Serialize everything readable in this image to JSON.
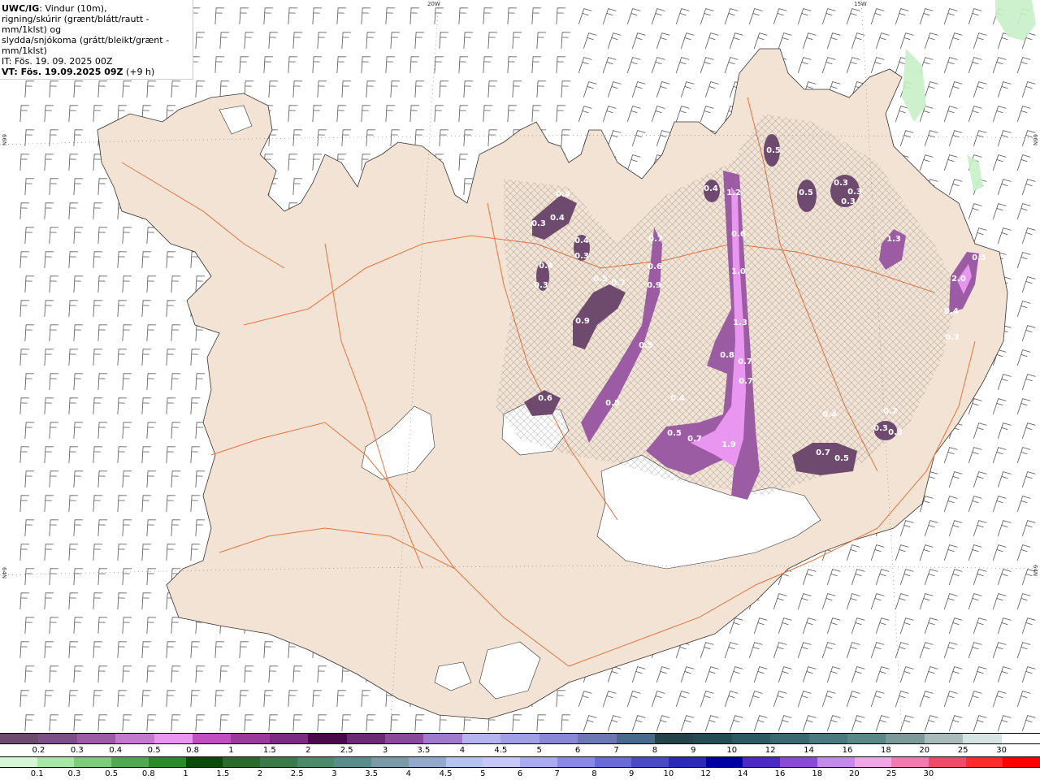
{
  "header": {
    "product": "UWC/IG",
    "desc1": ": Vindur (10m),",
    "desc2": "rigning/skúrir (grænt/blátt/rautt - mm/1klst) og",
    "desc3": "slydda/snjókoma (grátt/bleikt/grænt - mm/1klst)",
    "it": "IT: Fös. 19. 09. 2025 00Z",
    "vt": "VT: Fös. 19.09.2025 09Z",
    "lead": "(+9 h)"
  },
  "grid_labels": {
    "top": [
      "20W",
      "15W"
    ],
    "left": [
      "66N",
      "64N"
    ],
    "right": [
      "66N",
      "64N"
    ]
  },
  "precip_values": [
    "0.3",
    "0.4",
    "0.4",
    "0.4",
    "0.3",
    "0.4",
    "0.3",
    "0.5",
    "0.7",
    "0.9",
    "0.9",
    "0.6",
    "0.7",
    "0.5",
    "0.5",
    "0.6",
    "0.4",
    "1.2",
    "0.6",
    "1.0",
    "1.3",
    "0.8",
    "0.7",
    "0.7",
    "0.4",
    "0.5",
    "0.7",
    "1.9",
    "0.5",
    "0.3",
    "0.3",
    "0.3",
    "0.5",
    "1.3",
    "2.0",
    "0.4",
    "0.3",
    "0.4",
    "0.7",
    "0.5",
    "0.2",
    "0.3",
    "0.3",
    "0.5"
  ],
  "legend_precip": {
    "colors": [
      "#6e4a6e",
      "#7c4f86",
      "#9b5ca4",
      "#c17acc",
      "#e896f0",
      "#c24fc2",
      "#9a3a9a",
      "#7a2a80",
      "#4a0a4a",
      "#6a2a74",
      "#8a4a9a",
      "#a07acc",
      "#b4b4ee",
      "#a0a0e6",
      "#8888d6",
      "#6c78b4",
      "#4a6a8c",
      "#24444c",
      "#244c54",
      "#2c5a64",
      "#3a6a70",
      "#4a7a80",
      "#5a8888",
      "#7c9a9a",
      "#a8bcbc",
      "#d6e4e4",
      "#ffffff"
    ],
    "labels": [
      "0.2",
      "0.3",
      "0.4",
      "0.5",
      "0.8",
      "1",
      "1.5",
      "2",
      "2.5",
      "3",
      "3.5",
      "4",
      "4.5",
      "5",
      "6",
      "7",
      "8",
      "9",
      "10",
      "12",
      "14",
      "16",
      "18",
      "20",
      "25",
      "30"
    ]
  },
  "legend_snow": {
    "colors": [
      "#d6f5d6",
      "#a6e6a6",
      "#7ccc7c",
      "#50a850",
      "#2a8a2a",
      "#0a4a0a",
      "#2a6a2a",
      "#3a7a4a",
      "#4a8a6a",
      "#5a8c8c",
      "#7a9aa8",
      "#94a8cc",
      "#b4c4ee",
      "#c8c8f8",
      "#aaaaf0",
      "#8a8ae6",
      "#6a6ad6",
      "#4a4ac6",
      "#2a2ab6",
      "#0000a0",
      "#4a2ac0",
      "#8a4ad6",
      "#c48aea",
      "#f0a6e6",
      "#f27ab0",
      "#f04a6a",
      "#ff2a2a",
      "#ff0000"
    ],
    "labels": [
      "0.1",
      "0.3",
      "0.5",
      "0.8",
      "1",
      "1.5",
      "2",
      "2.5",
      "3",
      "3.5",
      "4",
      "4.5",
      "5",
      "6",
      "7",
      "8",
      "9",
      "10",
      "12",
      "14",
      "16",
      "18",
      "20",
      "25",
      "30"
    ]
  },
  "colors": {
    "land": "#f2e3d5",
    "roads": "#e8743c",
    "glacier": "#ffffff",
    "wind_barb": "#555555"
  }
}
